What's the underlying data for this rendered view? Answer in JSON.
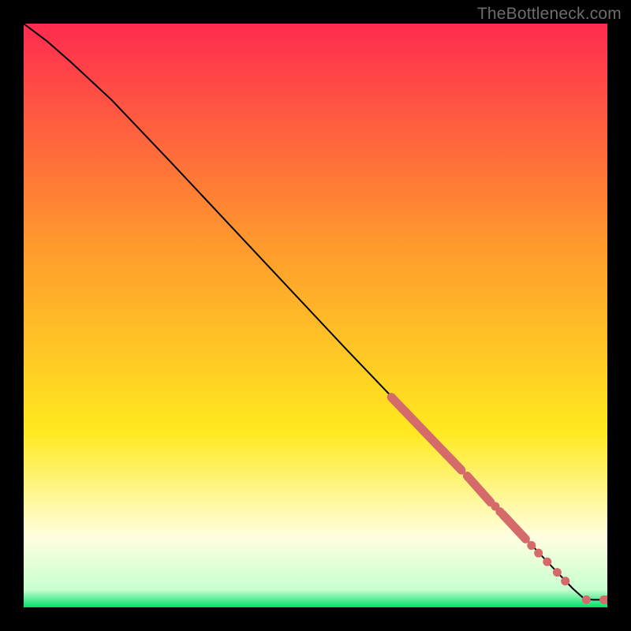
{
  "watermark": "TheBottleneck.com",
  "chart_data": {
    "type": "line",
    "title": "",
    "xlabel": "",
    "ylabel": "",
    "xlim": [
      0,
      100
    ],
    "ylim": [
      0,
      100
    ],
    "grid": false,
    "legend": false,
    "background_gradient": {
      "top": "#ff2b4f",
      "mid1": "#ff9a2d",
      "mid2": "#ffe91f",
      "pale": "#ffffe0",
      "green": "#00e06b"
    },
    "curve": [
      {
        "x": 0,
        "y": 100
      },
      {
        "x": 4,
        "y": 97
      },
      {
        "x": 8,
        "y": 93.5
      },
      {
        "x": 15,
        "y": 87
      },
      {
        "x": 25,
        "y": 76.5
      },
      {
        "x": 40,
        "y": 60.5
      },
      {
        "x": 55,
        "y": 44.5
      },
      {
        "x": 66,
        "y": 33
      },
      {
        "x": 75,
        "y": 23.5
      },
      {
        "x": 83,
        "y": 15
      },
      {
        "x": 90,
        "y": 7.5
      },
      {
        "x": 94,
        "y": 3.3
      },
      {
        "x": 96,
        "y": 1.5
      },
      {
        "x": 97.5,
        "y": 1.3
      },
      {
        "x": 99,
        "y": 1.3
      },
      {
        "x": 100,
        "y": 1.3
      }
    ],
    "highlight_segments": [
      {
        "from": {
          "x": 63,
          "y": 36
        },
        "to": {
          "x": 75,
          "y": 23.5
        }
      },
      {
        "from": {
          "x": 76,
          "y": 22.5
        },
        "to": {
          "x": 80,
          "y": 18
        }
      },
      {
        "from": {
          "x": 82,
          "y": 16
        },
        "to": {
          "x": 86,
          "y": 11.7
        }
      }
    ],
    "highlight_dots": [
      {
        "x": 80.8,
        "y": 17.3
      },
      {
        "x": 81.6,
        "y": 16.4
      },
      {
        "x": 87.0,
        "y": 10.6
      },
      {
        "x": 88.2,
        "y": 9.3
      },
      {
        "x": 89.7,
        "y": 7.8
      },
      {
        "x": 91.4,
        "y": 6.0
      },
      {
        "x": 92.8,
        "y": 4.5
      }
    ],
    "end_dots": [
      {
        "x": 96.4,
        "y": 1.3
      },
      {
        "x": 99.4,
        "y": 1.3
      },
      {
        "x": 100.0,
        "y": 1.3
      }
    ],
    "colors": {
      "curve": "#000000",
      "highlight": "#d46a6a"
    }
  }
}
